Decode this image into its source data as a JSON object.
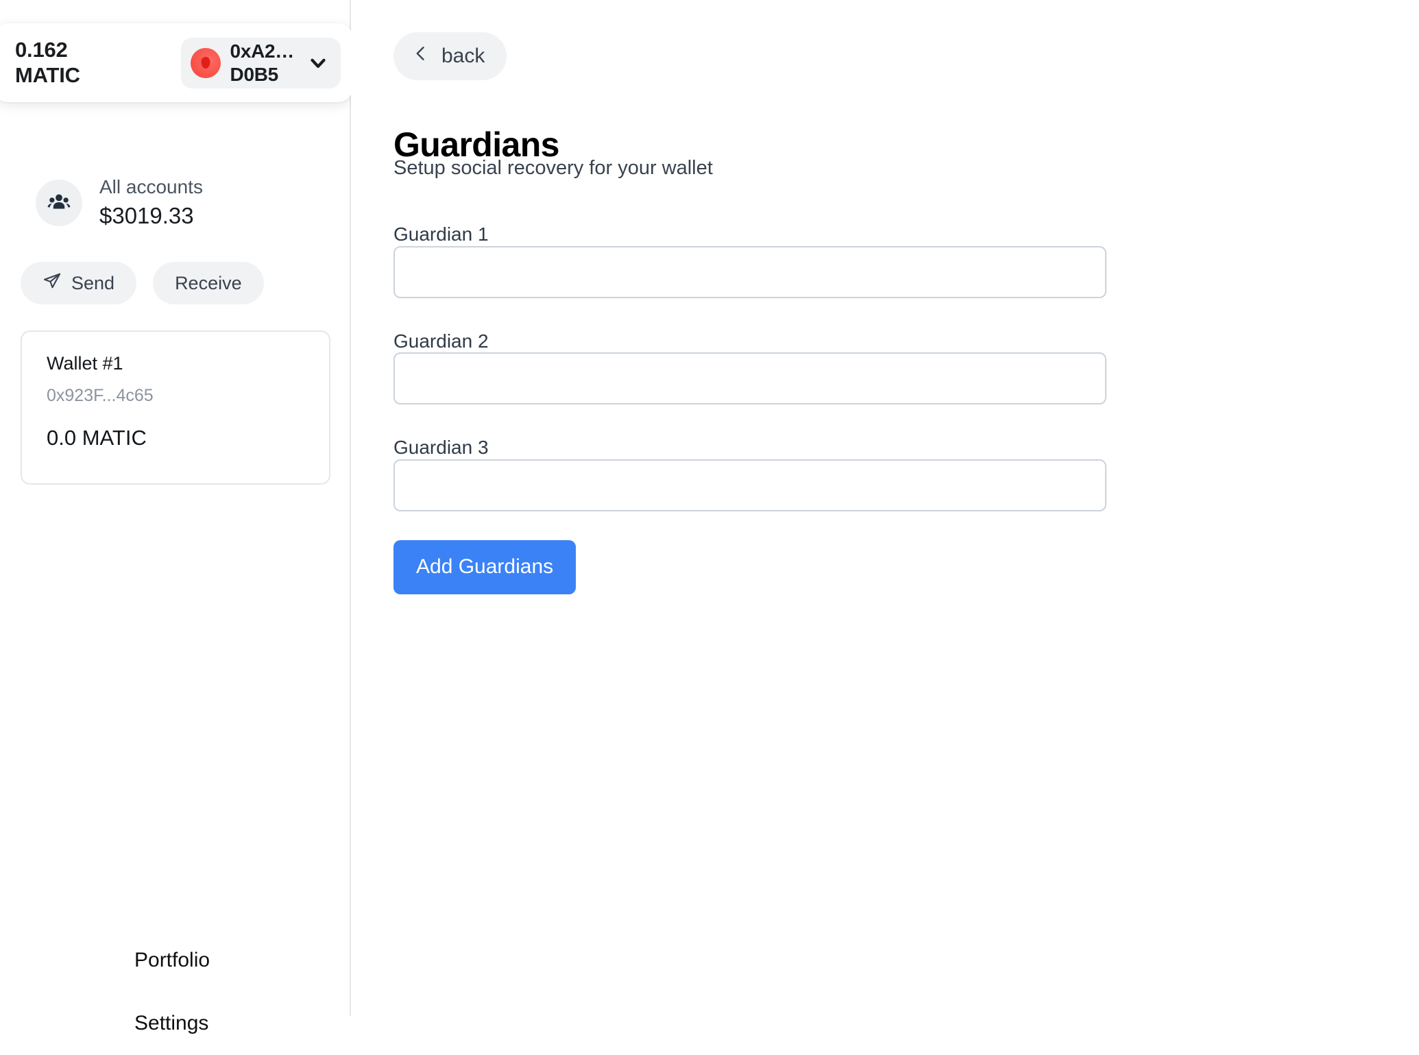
{
  "sidebar": {
    "balance_card": {
      "amount": "0.162\nMATIC",
      "account_address": "0xA2…\nD0B5",
      "avatar_color": "#fb5a52",
      "chevron_icon": "chevron-down-icon"
    },
    "all_accounts": {
      "icon": "people-group-icon",
      "label": "All accounts",
      "total": "$3019.33"
    },
    "actions": [
      {
        "label": "Send",
        "icon": "send-paper-plane-icon"
      },
      {
        "label": "Receive",
        "icon": ""
      }
    ],
    "wallet_card": {
      "name": "Wallet #1",
      "address": "0x923F...4c65",
      "balance": "0.0 MATIC"
    },
    "nav": [
      {
        "label": "Portfolio"
      },
      {
        "label": "Settings"
      }
    ]
  },
  "main": {
    "back_button": {
      "label": "back",
      "icon": "chevron-left-icon"
    },
    "title": "Guardians",
    "subtitle": "Setup social recovery for your wallet",
    "fields": [
      {
        "label": "Guardian 1",
        "value": "",
        "placeholder": ""
      },
      {
        "label": "Guardian 2",
        "value": "",
        "placeholder": ""
      },
      {
        "label": "Guardian 3",
        "value": "",
        "placeholder": ""
      }
    ],
    "submit": {
      "label": "Add Guardians",
      "color": "#3b82f6"
    }
  }
}
